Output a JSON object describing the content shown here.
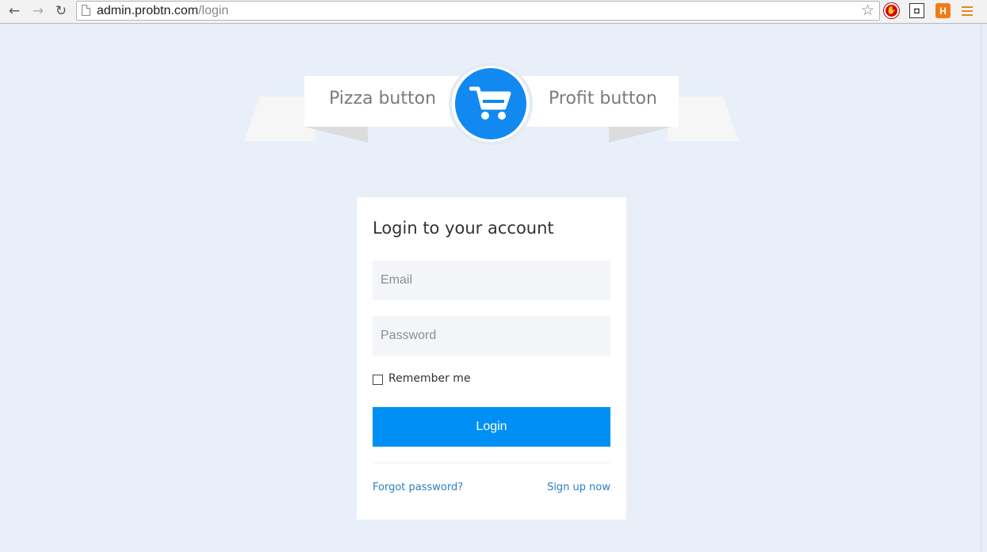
{
  "browser": {
    "back_icon": "arrow-left-icon",
    "forward_icon": "arrow-right-icon",
    "reload_icon": "reload-icon",
    "url_host": "admin.probtn.com",
    "url_path": "/login",
    "bookmark_icon": "star-icon",
    "extensions": [
      "stop-icon",
      "mask-icon",
      "h-icon"
    ],
    "extension_h_label": "H",
    "menu_icon": "hamburger-menu-icon"
  },
  "banner": {
    "left_text": "Pizza button",
    "right_text": "Profit button",
    "icon": "shopping-cart-icon",
    "accent": "#1189f0"
  },
  "login": {
    "title": "Login to your account",
    "email_placeholder": "Email",
    "email_value": "",
    "password_placeholder": "Password",
    "password_value": "",
    "remember_label": "Remember me",
    "remember_checked": false,
    "submit_label": "Login",
    "forgot_link": "Forgot password?",
    "signup_link": "Sign up now",
    "button_color": "#0090f5",
    "link_color": "#2a7fc1"
  }
}
